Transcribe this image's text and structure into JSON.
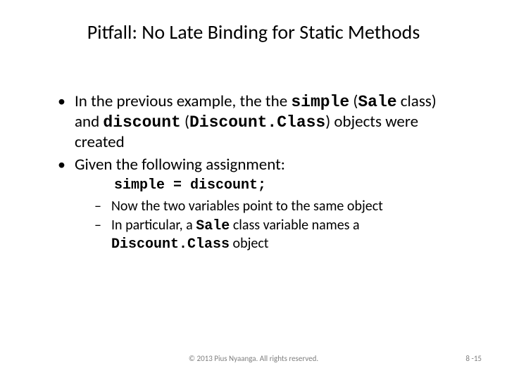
{
  "title": "Pitfall:  No Late Binding for Static Methods",
  "bullets": {
    "b1_pre": "In the previous example, the the ",
    "b1_c1": "simple",
    "b1_mid1": " (",
    "b1_c2": "Sale",
    "b1_mid2": " class) and ",
    "b1_c3": "discount",
    "b1_mid3": " (",
    "b1_c4": "Discount.Class",
    "b1_post": ") objects were created",
    "b2": "Given the following assignment:"
  },
  "codeline": "simple = discount;",
  "sub": {
    "s1": "Now the two variables point to the same object",
    "s2_pre": "In particular, a ",
    "s2_c1": "Sale",
    "s2_mid": " class variable names a ",
    "s2_c2": "Discount.Class",
    "s2_post": " object"
  },
  "footer": {
    "center": "© 2013 Pius Nyaanga. All rights reserved.",
    "right": "8 -15"
  }
}
